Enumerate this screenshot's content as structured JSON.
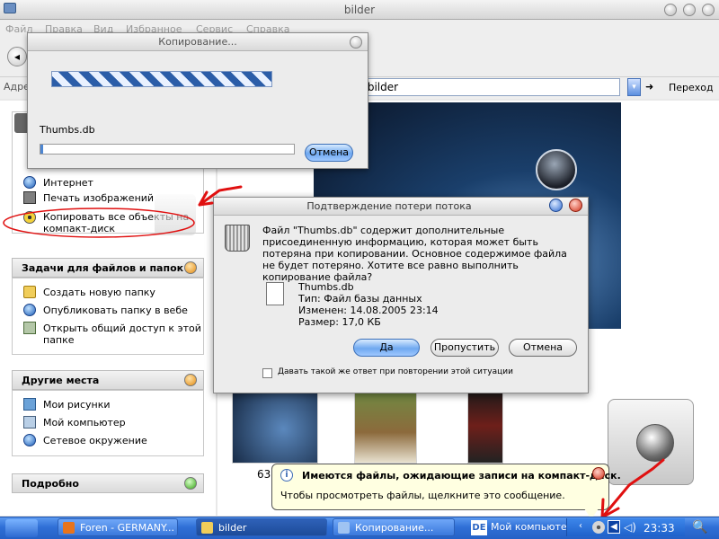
{
  "window": {
    "title": "bilder",
    "menu": [
      "Файл",
      "Правка",
      "Вид",
      "Избранное",
      "Сервис",
      "Справка"
    ],
    "address_label": "Адре",
    "address_value": "и\\bilder",
    "go_label": "Переход"
  },
  "copy_dialog": {
    "title": "Копирование...",
    "filename": "Thumbs.db",
    "progress": 0.01,
    "cancel_label": "Отмена"
  },
  "left_panel": {
    "top_items": [
      "Интернет",
      "Печать изображений",
      "Копировать все объекты на",
      "компакт-диск"
    ],
    "file_tasks": {
      "title": "Задачи для файлов и папок",
      "items": [
        "Создать новую папку",
        "Опубликовать папку в вебе",
        "Открыть общий доступ к этой",
        "папке"
      ]
    },
    "other_places": {
      "title": "Другие места",
      "items": [
        "Мои рисунки",
        "Мой компьютер",
        "Сетевое окружение"
      ]
    },
    "details": {
      "title": "Подробно"
    }
  },
  "confirm_dialog": {
    "title": "Подтверждение потери потока",
    "message": "Файл \"Thumbs.db\" содержит дополнительные присоединенную информацию, которая может быть потеряна при копировании. Основное содержимое файла не будет потеряно. Хотите все равно выполнить копирование файла?",
    "file_name": "Thumbs.db",
    "file_type": "Тип: Файл базы данных",
    "file_modified": "Изменен: 14.08.2005 23:14",
    "file_size": "Размер: 17,0 КБ",
    "yes_label": "Да",
    "skip_label": "Пропустить",
    "cancel_label": "Отмена",
    "apply_all_label": "Давать такой же ответ при повторении этой ситуации"
  },
  "content": {
    "thumb_caption": "63"
  },
  "balloon": {
    "title": "Имеются файлы, ожидающие записи на компакт-диск.",
    "text": "Чтобы просмотреть файлы, щелкните это сообщение."
  },
  "taskbar": {
    "buttons": [
      {
        "label": "Foren - GERMANY...",
        "icon_color": "#e8741c"
      },
      {
        "label": "bilder",
        "icon_color": "#f0cd5a"
      },
      {
        "label": "Копирование...",
        "icon_color": "#9fc3f2"
      },
      {
        "label": "Мой компьютер",
        "icon_color": "#2a64c2"
      }
    ],
    "tray_badge": "DE",
    "clock": "23:33"
  },
  "colors": {
    "annotation_red": "#e01010",
    "taskbar_blue": "#2f6fd6"
  }
}
